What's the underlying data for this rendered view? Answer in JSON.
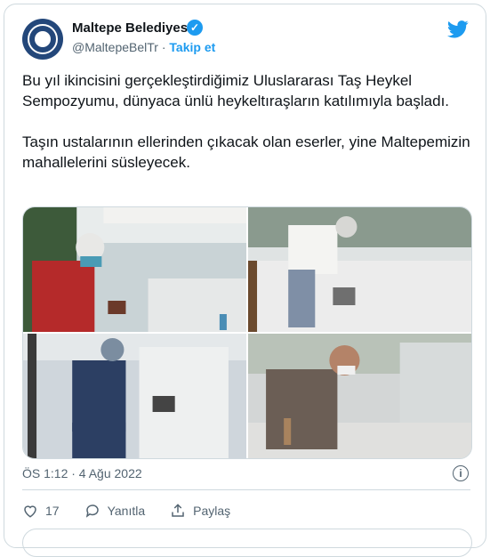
{
  "author": {
    "name": "Maltepe Belediyesi",
    "handle": "@MaltepeBelTr",
    "separator": " · ",
    "follow_label": "Takip et",
    "verified_icon": "verified-badge-icon",
    "avatar_icon": "municipality-logo-icon"
  },
  "tweet": {
    "paragraph1": "Bu yıl ikincisini gerçekleştirdiğimiz Uluslararası Taş Heykel Sempozyumu, dünyaca ünlü heykeltıraşların katılımıyla başladı.",
    "paragraph2": "Taşın ustalarının ellerinden çıkacak olan eserler, yine Maltepemizin mahallelerini süsleyecek.",
    "timestamp": "ÖS 1:12 · 4 Ağu 2022"
  },
  "actions": {
    "likes": "17",
    "reply_label": "Yanıtla",
    "share_label": "Paylaş"
  },
  "more_button": "",
  "colors": {
    "accent": "#1d9bf0",
    "muted": "#536471",
    "border": "#cfd9de"
  }
}
